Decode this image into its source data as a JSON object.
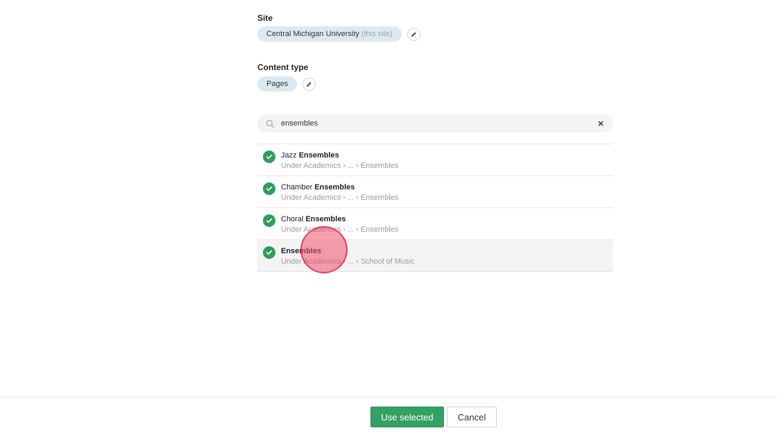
{
  "site": {
    "label": "Site",
    "chip_name": "Central Michigan University",
    "chip_note": "(this site)"
  },
  "content_type": {
    "label": "Content type",
    "chip_name": "Pages"
  },
  "search": {
    "value": "ensembles",
    "icon": "search-icon",
    "clear_icon": "close-icon"
  },
  "results": [
    {
      "prefix": "Jazz",
      "match": "Ensembles",
      "path_start": "Under Academics",
      "path_end": "Ensembles",
      "checked": true
    },
    {
      "prefix": "Chamber",
      "match": "Ensembles",
      "path_start": "Under Academics",
      "path_end": "Ensembles",
      "checked": true
    },
    {
      "prefix": "Choral",
      "match": "Ensembles",
      "path_start": "Under Academics",
      "path_end": "Ensembles",
      "checked": true
    },
    {
      "prefix": "",
      "match": "Ensembles",
      "path_start": "Under Academics",
      "path_end": "School of Music",
      "checked": true
    }
  ],
  "path_separator": " › ... › ",
  "footer": {
    "use_selected": "Use selected",
    "cancel": "Cancel"
  },
  "colors": {
    "accent_green": "#33a163",
    "chip_blue": "#dde9f1",
    "cursor_pink": "#ee506e"
  }
}
